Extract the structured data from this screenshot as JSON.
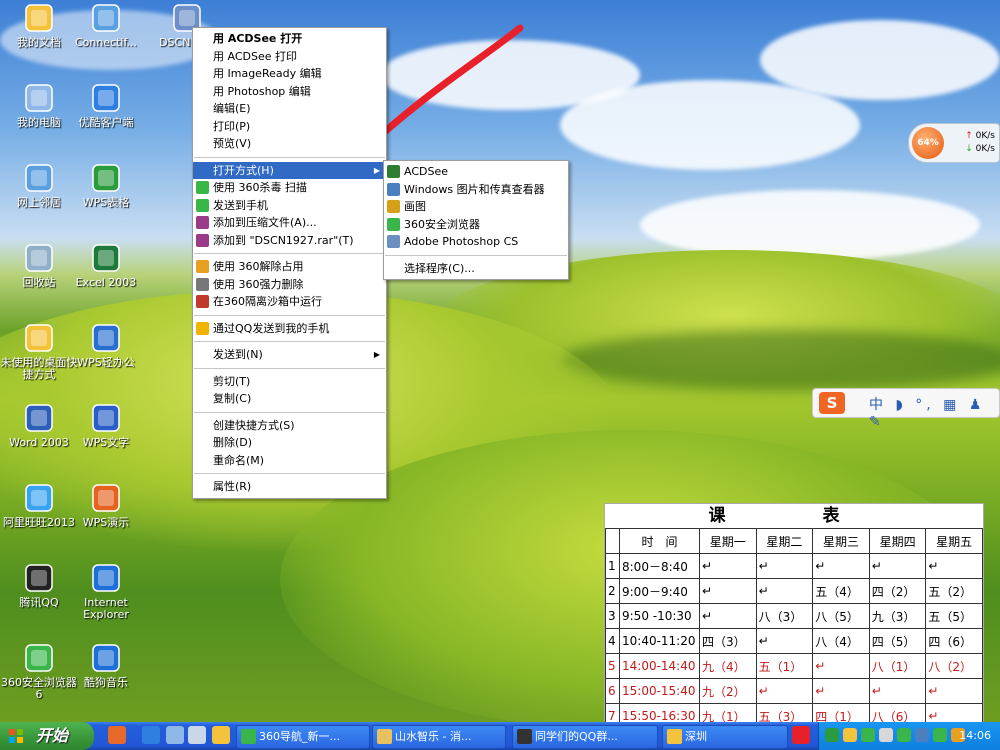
{
  "desktop_icons": [
    {
      "label": "我的文档",
      "icon": "my-documents-icon",
      "color": "#f5c33b"
    },
    {
      "label": "Connectif...",
      "icon": "network-connection-icon",
      "color": "#5aa0e0"
    },
    {
      "label": "DSCN19...",
      "icon": "image-file-icon",
      "color": "#6c8fc9"
    },
    {
      "label": "我的电脑",
      "icon": "my-computer-icon",
      "color": "#8fb8e8"
    },
    {
      "label": "优酷客户端",
      "icon": "youku-icon",
      "color": "#2f7fe0"
    },
    {
      "label": "网上邻居",
      "icon": "network-places-icon",
      "color": "#5aa0e0"
    },
    {
      "label": "WPS表格",
      "icon": "wps-spreadsheet-icon",
      "color": "#2a9c3e"
    },
    {
      "label": "回收站",
      "icon": "recycle-bin-icon",
      "color": "#8fb0c8"
    },
    {
      "label": "Excel 2003",
      "icon": "excel-icon",
      "color": "#1d7a3a"
    },
    {
      "label": "未使用的桌面快捷方式",
      "icon": "folder-icon",
      "color": "#f5c33b"
    },
    {
      "label": "WPS轻办公",
      "icon": "wps-office-icon",
      "color": "#2a6fd0"
    },
    {
      "label": "Word 2003",
      "icon": "word-icon",
      "color": "#2b5fb8"
    },
    {
      "label": "WPS文字",
      "icon": "wps-writer-icon",
      "color": "#2a5fc8"
    },
    {
      "label": "阿里旺旺2013",
      "icon": "aliwangwang-icon",
      "color": "#3aa3f0"
    },
    {
      "label": "WPS演示",
      "icon": "wps-presentation-icon",
      "color": "#e5621f"
    },
    {
      "label": "腾讯QQ",
      "icon": "qq-icon",
      "color": "#222222"
    },
    {
      "label": "Internet Explorer",
      "icon": "ie-icon",
      "color": "#1f6fd8"
    },
    {
      "label": "360安全浏览器6",
      "icon": "360-browser-icon",
      "color": "#3ab54a"
    },
    {
      "label": "酷狗音乐",
      "icon": "kugou-icon",
      "color": "#1f6fd8"
    }
  ],
  "context_menu": {
    "items": [
      {
        "label": "用 ACDSee 打开",
        "bold": true
      },
      {
        "label": "用 ACDSee 打印"
      },
      {
        "label": "用 ImageReady 编辑"
      },
      {
        "label": "用 Photoshop 编辑"
      },
      {
        "label": "编辑(E)"
      },
      {
        "label": "打印(P)"
      },
      {
        "label": "预览(V)"
      },
      {
        "sep": true
      },
      {
        "label": "打开方式(H)",
        "highlighted": true,
        "submenu": true
      },
      {
        "label": "使用 360杀毒 扫描",
        "icon": "shield-icon",
        "color": "#3ab54a"
      },
      {
        "label": "发送到手机",
        "icon": "phone-icon",
        "color": "#3ab54a"
      },
      {
        "label": "添加到压缩文件(A)...",
        "icon": "archive-icon",
        "color": "#9c3a8a"
      },
      {
        "label": "添加到 \"DSCN1927.rar\"(T)",
        "icon": "archive-icon",
        "color": "#9c3a8a"
      },
      {
        "sep": true
      },
      {
        "label": "使用 360解除占用",
        "icon": "unlock-icon",
        "color": "#e8a020"
      },
      {
        "label": "使用 360强力删除",
        "icon": "delete-icon",
        "color": "#777777"
      },
      {
        "label": "在360隔离沙箱中运行",
        "icon": "sandbox-icon",
        "color": "#c0392b"
      },
      {
        "sep": true
      },
      {
        "label": "通过QQ发送到我的手机",
        "icon": "qq-icon",
        "color": "#f0b400"
      },
      {
        "sep": true
      },
      {
        "label": "发送到(N)",
        "submenu": true
      },
      {
        "sep": true
      },
      {
        "label": "剪切(T)"
      },
      {
        "label": "复制(C)"
      },
      {
        "sep": true
      },
      {
        "label": "创建快捷方式(S)"
      },
      {
        "label": "删除(D)"
      },
      {
        "label": "重命名(M)"
      },
      {
        "sep": true
      },
      {
        "label": "属性(R)"
      }
    ]
  },
  "open_with_menu": {
    "items": [
      {
        "label": "ACDSee",
        "icon": "acdsee-icon",
        "color": "#2e7d32"
      },
      {
        "label": "Windows 图片和传真查看器",
        "icon": "image-viewer-icon",
        "color": "#4a7fc0"
      },
      {
        "label": "画图",
        "icon": "paint-icon",
        "color": "#d4a017"
      },
      {
        "label": "360安全浏览器",
        "icon": "360-browser-icon",
        "color": "#3ab54a"
      },
      {
        "label": "Adobe Photoshop CS",
        "icon": "photoshop-icon",
        "color": "#6a8fc0"
      },
      {
        "sep": true
      },
      {
        "label": "选择程序(C)..."
      }
    ]
  },
  "net_widget": {
    "percent": "64%",
    "up": "0K/s",
    "down": "0K/s"
  },
  "ime_bar": {
    "logo": "S",
    "tools": "中 ◗ °, ▦ ♟ ✎"
  },
  "timetable": {
    "title": "课　表",
    "headers": [
      "时　间",
      "星期一",
      "星期二",
      "星期三",
      "星期四",
      "星期五"
    ],
    "rows": [
      {
        "no": "1",
        "time": "8:00－8:40",
        "cells": [
          "↵",
          "↵",
          "↵",
          "↵",
          "↵"
        ],
        "red": false
      },
      {
        "no": "2",
        "time": "9:00－9:40",
        "cells": [
          "↵",
          "↵",
          "五（4）",
          "四（2）",
          "五（2）"
        ],
        "red": false
      },
      {
        "no": "3",
        "time": "9:50 -10:30",
        "cells": [
          "↵",
          "八（3）",
          "八（5）",
          "九（3）",
          "五（5）"
        ],
        "red": false
      },
      {
        "no": "4",
        "time": "10:40-11:20",
        "cells": [
          "四（3）",
          "↵",
          "八（4）",
          "四（5）",
          "四（6）"
        ],
        "red": false
      },
      {
        "no": "5",
        "time": "14:00-14:40",
        "cells": [
          "九（4）",
          "五（1）",
          "↵",
          "八（1）",
          "八（2）"
        ],
        "red": true
      },
      {
        "no": "6",
        "time": "15:00-15:40",
        "cells": [
          "九（2）",
          "↵",
          "↵",
          "↵",
          "↵"
        ],
        "red": true
      },
      {
        "no": "7",
        "time": "15:50-16:30",
        "cells": [
          "九（1）",
          "五（3）",
          "四（1）",
          "八（6）",
          "↵"
        ],
        "red": true
      }
    ]
  },
  "taskbar": {
    "start": "开始",
    "tasks": [
      {
        "label": "360导航_新一...",
        "color": "#3ab54a"
      },
      {
        "label": "山水智乐 - 消...",
        "color": "#e8c060"
      },
      {
        "label": "同学们的QQ群...",
        "color": "#333333"
      },
      {
        "label": "深圳",
        "color": "#f5c33b"
      }
    ],
    "clock": "14:06"
  },
  "colors": {
    "highlight": "#316ac5",
    "taskbar": "#245edb",
    "start": "#3c9a3c",
    "arrow": "#e8202a"
  }
}
